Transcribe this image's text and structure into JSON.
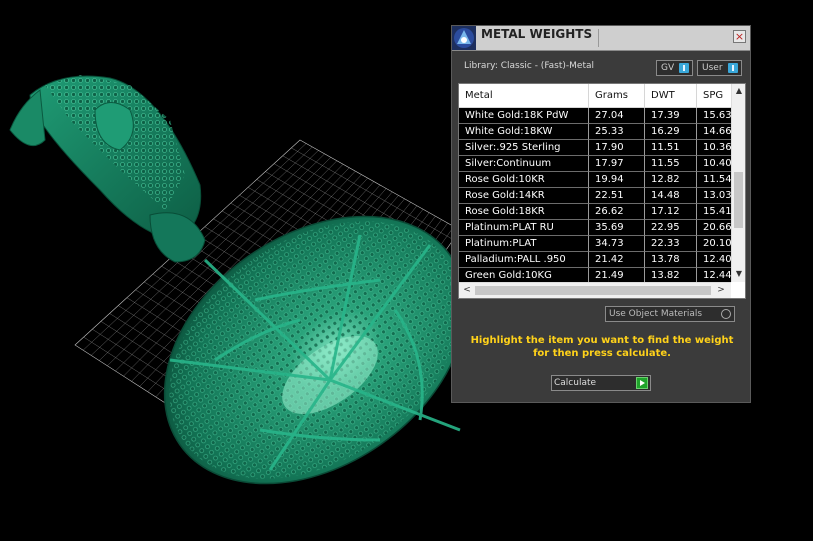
{
  "dialog": {
    "title": "METAL WEIGHTS",
    "close_label": "×",
    "library": "Library: Classic - (Fast)-Metal",
    "toggles": [
      {
        "label": "GV"
      },
      {
        "label": "User"
      }
    ],
    "use_object_materials": "Use Object Materials",
    "instruction": "Highlight the item you want to find the weight for then press calculate.",
    "calculate_label": "Calculate",
    "scroll_up": "▲",
    "scroll_down": "▼",
    "scroll_left": "<",
    "scroll_right": ">"
  },
  "table": {
    "columns": [
      "Metal",
      "Grams",
      "DWT",
      "SPG"
    ],
    "rows": [
      [
        "White Gold:18K PdW",
        "27.04",
        "17.39",
        "15.63"
      ],
      [
        "White Gold:18KW",
        "25.33",
        "16.29",
        "14.66"
      ],
      [
        "Silver:.925 Sterling",
        "17.90",
        "11.51",
        "10.36"
      ],
      [
        "Silver:Continuum",
        "17.97",
        "11.55",
        "10.40"
      ],
      [
        "Rose Gold:10KR",
        "19.94",
        "12.82",
        "11.54"
      ],
      [
        "Rose Gold:14KR",
        "22.51",
        "14.48",
        "13.03"
      ],
      [
        "Rose Gold:18KR",
        "26.62",
        "17.12",
        "15.41"
      ],
      [
        "Platinum:PLAT RU",
        "35.69",
        "22.95",
        "20.66"
      ],
      [
        "Platinum:PLAT",
        "34.73",
        "22.33",
        "20.10"
      ],
      [
        "Palladium:PALL .950",
        "21.42",
        "13.78",
        "12.40"
      ],
      [
        "Green Gold:10KG",
        "21.49",
        "13.82",
        "12.44"
      ]
    ]
  },
  "colors": {
    "accent_text": "#ffd21a",
    "model_green": "#1a8a66",
    "axis_red": "#e01010",
    "toggle_blue": "#39a7d9"
  }
}
